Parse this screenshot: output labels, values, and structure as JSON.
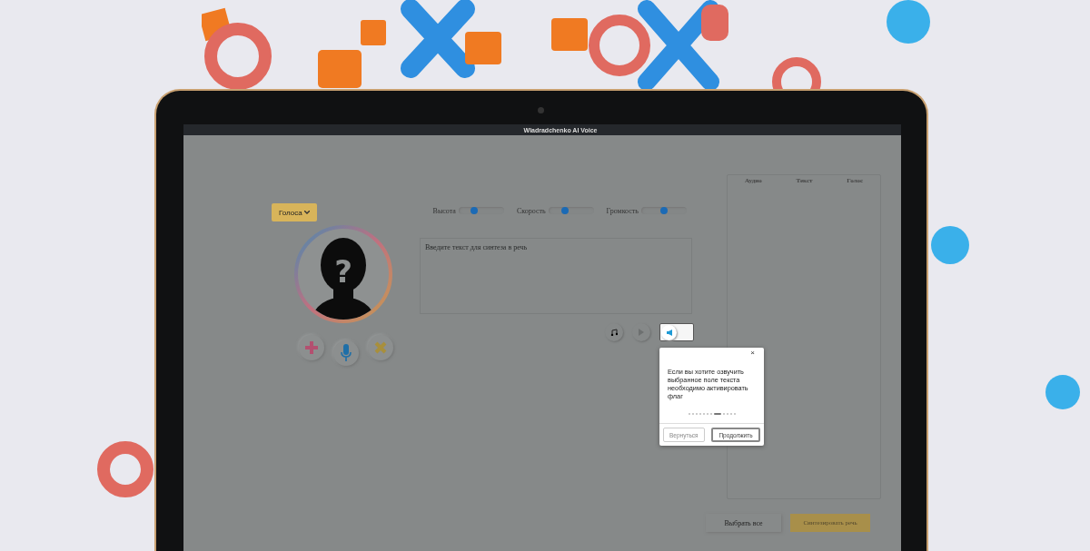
{
  "window": {
    "title": "Wladradchenko AI Voice"
  },
  "voice_menu": {
    "label": "Голоса"
  },
  "avatar": {
    "mark": "?"
  },
  "sliders": [
    {
      "label": "Высота",
      "level": 0.35
    },
    {
      "label": "Скорость",
      "level": 0.37
    },
    {
      "label": "Громкость",
      "level": 0.5
    }
  ],
  "text_input": {
    "placeholder": "Введите текст для синтеза в речь"
  },
  "speak_selected_toggle": {
    "checked": false
  },
  "tour": {
    "text": "Если вы хотите озвучить выбранное поле текста необходимо активировать флаг",
    "close": "×",
    "steps": [
      {
        "selected": false
      },
      {
        "selected": false
      },
      {
        "selected": false
      },
      {
        "selected": false
      },
      {
        "selected": false
      },
      {
        "selected": false
      },
      {
        "selected": false
      },
      {
        "selected": true
      },
      {
        "selected": false
      },
      {
        "selected": false
      },
      {
        "selected": false
      },
      {
        "selected": false
      }
    ],
    "buttons": [
      "Вернуться",
      "Продолжить"
    ]
  },
  "table": {
    "columns": [
      "Аудио",
      "Текст",
      "Голос"
    ]
  },
  "buttons": [
    "Выбрать все",
    "Синтезировать речь"
  ]
}
